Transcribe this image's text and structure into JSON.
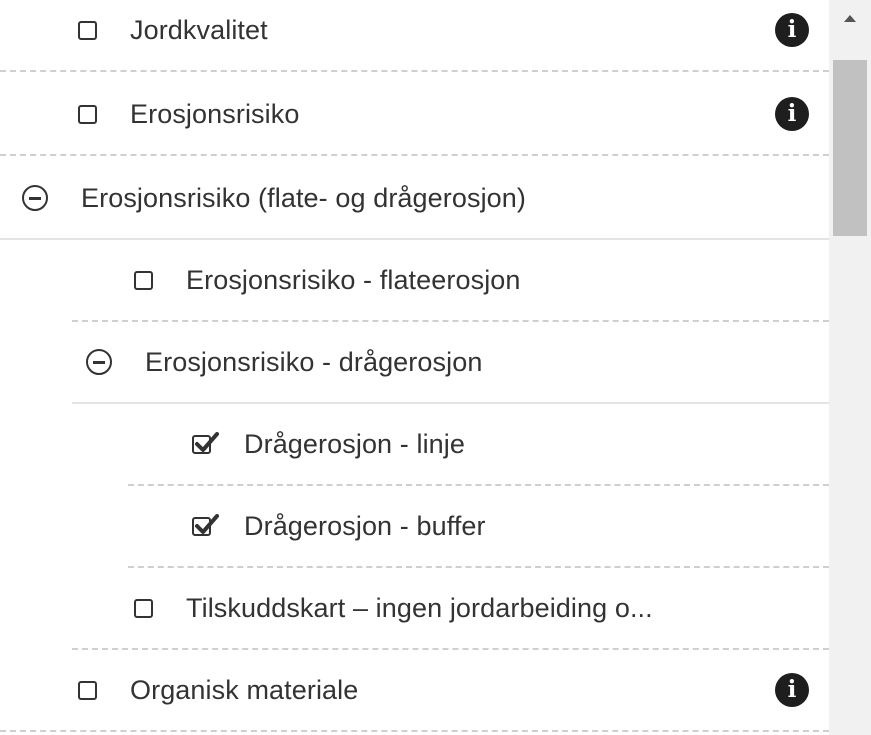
{
  "layers": [
    {
      "label": "Jordkvalitet",
      "checked": false,
      "info": true
    },
    {
      "label": "Erosjonsrisiko",
      "checked": false,
      "info": true
    },
    {
      "label": "Erosjonsrisiko (flate- og drågerosjon)",
      "expanded": true
    },
    {
      "label": "Erosjonsrisiko - flateerosjon",
      "checked": false
    },
    {
      "label": "Erosjonsrisiko - drågerosjon",
      "expanded": true
    },
    {
      "label": "Drågerosjon - linje",
      "checked": true
    },
    {
      "label": "Drågerosjon - buffer",
      "checked": true
    },
    {
      "label": "Tilskuddskart – ingen jordarbeiding o...",
      "checked": false
    },
    {
      "label": "Organisk materiale",
      "checked": false,
      "info": true
    }
  ],
  "icons": {
    "info": "info-icon",
    "collapse": "minus-circle-icon",
    "checkbox": "checkbox-icon",
    "scroll_up": "caret-up-icon"
  },
  "colors": {
    "text": "#333333",
    "icon": "#1e1e1e",
    "divider": "#cfcfcf",
    "scrollbar_track": "#f1f1f1",
    "scrollbar_thumb": "#c1c1c1"
  }
}
